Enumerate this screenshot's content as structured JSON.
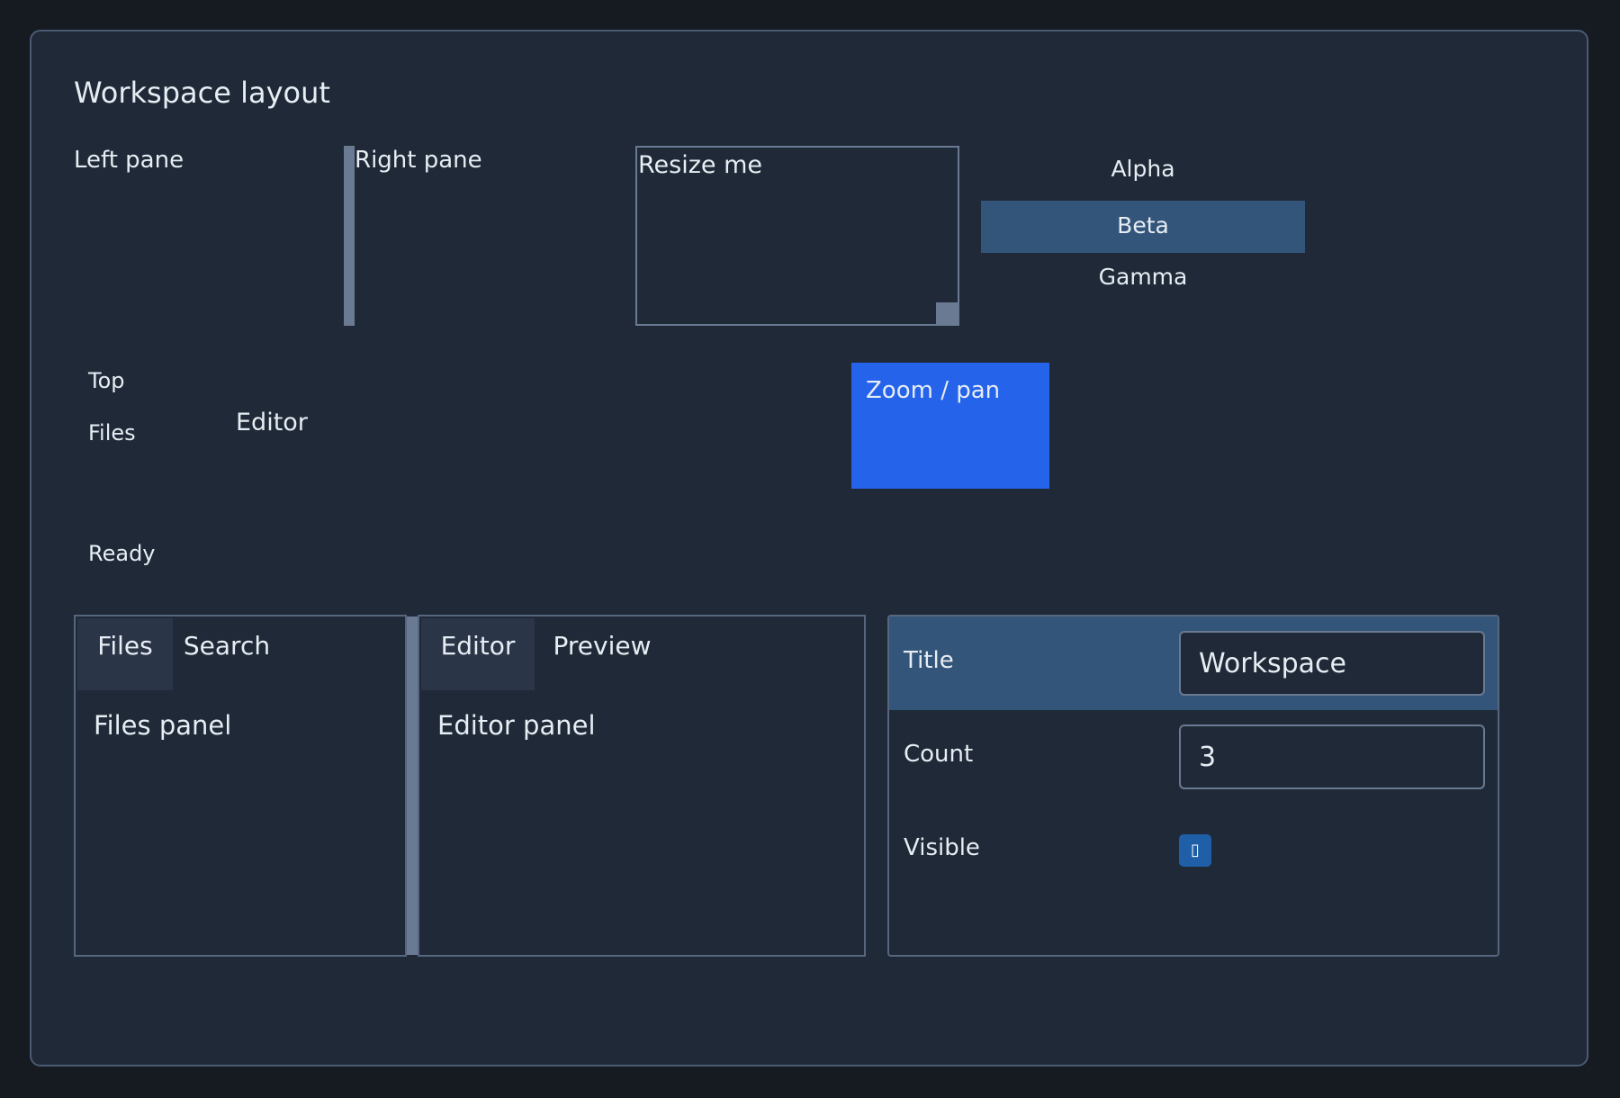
{
  "window": {
    "title": "Workspace layout"
  },
  "split_h": {
    "left_label": "Left pane",
    "right_label": "Right pane"
  },
  "resizable": {
    "label": "Resize me"
  },
  "list": {
    "items": [
      {
        "label": "Alpha"
      },
      {
        "label": "Beta"
      },
      {
        "label": "Gamma"
      }
    ],
    "selected": "Beta"
  },
  "dock": {
    "top_label": "Top",
    "files_label": "Files",
    "editor_label": "Editor",
    "status_label": "Ready"
  },
  "zoom": {
    "label": "Zoom / pan"
  },
  "left_tabs": {
    "tabs": [
      {
        "label": "Files"
      },
      {
        "label": "Search"
      }
    ],
    "active": "Files",
    "panel_text": "Files panel"
  },
  "right_tabs": {
    "tabs": [
      {
        "label": "Editor"
      },
      {
        "label": "Preview"
      }
    ],
    "active": "Editor",
    "panel_text": "Editor panel"
  },
  "properties": {
    "rows": [
      {
        "label": "Title",
        "value": "Workspace"
      },
      {
        "label": "Count",
        "value": "3"
      },
      {
        "label": "Visible",
        "checked": true,
        "check_glyph": "▯"
      }
    ]
  },
  "colors": {
    "accent": "#2563eb",
    "selected": "#34557a",
    "background": "#1f2937"
  }
}
